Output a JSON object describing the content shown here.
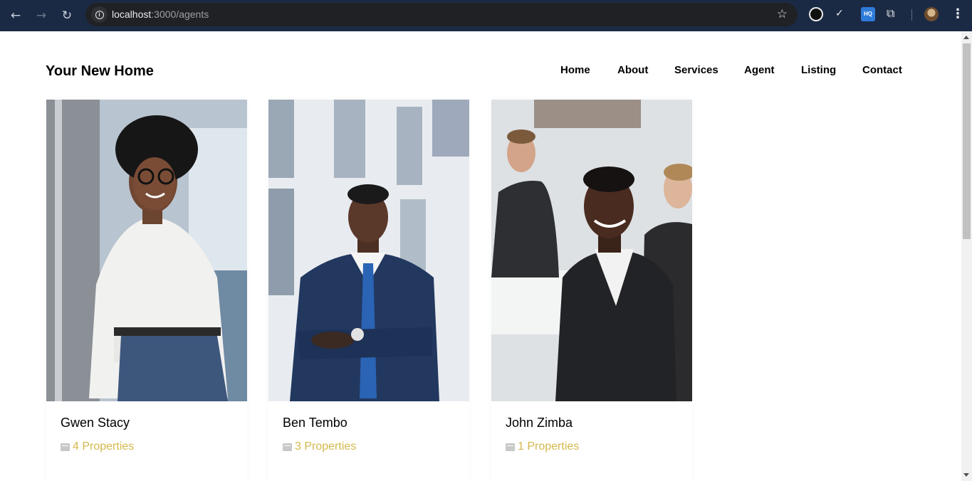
{
  "browser": {
    "url_host": "localhost",
    "url_path": ":3000/agents",
    "ext3_label": "HQ"
  },
  "site": {
    "brand": "Your New Home",
    "nav": [
      "Home",
      "About",
      "Services",
      "Agent",
      "Listing",
      "Contact"
    ]
  },
  "agents": [
    {
      "name": "Gwen Stacy",
      "properties": "4 Properties"
    },
    {
      "name": "Ben Tembo",
      "properties": "3 Properties"
    },
    {
      "name": "John Zimba",
      "properties": "1 Properties"
    }
  ],
  "colors": {
    "chrome": "#1b2a44",
    "accent": "#d4b84c"
  }
}
